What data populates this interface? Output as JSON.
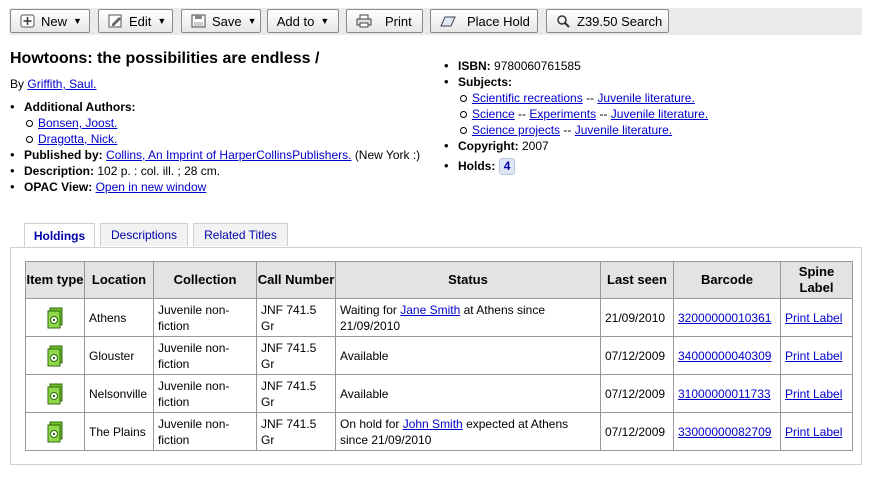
{
  "toolbar": {
    "new": "New",
    "edit": "Edit",
    "save": "Save",
    "add_to": "Add to",
    "print": "Print",
    "place_hold": "Place Hold",
    "z3950": "Z39.50 Search"
  },
  "biblio": {
    "title": "Howtoons: the possibilities are endless /",
    "by_prefix": "By",
    "author": "Griffith, Saul.",
    "additional_authors_label": "Additional Authors:",
    "additional_authors": [
      "Bonsen, Joost.",
      "Dragotta, Nick."
    ],
    "published_label": "Published by:",
    "publisher_link": "Collins, An Imprint of HarperCollinsPublishers.",
    "publisher_place": "(New York :)",
    "description_label": "Description:",
    "description": "102 p. : col. ill. ; 28 cm.",
    "opac_label": "OPAC View:",
    "opac_link": "Open in new window",
    "isbn_label": "ISBN:",
    "isbn": "9780060761585",
    "subjects_label": "Subjects:",
    "subjects": [
      {
        "a": "Scientific recreations",
        "b": "",
        "c": "Juvenile literature."
      },
      {
        "a": "Science",
        "b": "Experiments",
        "c": "Juvenile literature."
      },
      {
        "a": "Science projects",
        "b": "",
        "c": "Juvenile literature."
      }
    ],
    "separator": "--",
    "copyright_label": "Copyright:",
    "copyright": "2007",
    "holds_label": "Holds:",
    "holds": "4"
  },
  "tabs": [
    "Holdings",
    "Descriptions",
    "Related Titles"
  ],
  "holdings": {
    "headers": [
      "Item type",
      "Location",
      "Collection",
      "Call Number",
      "Status",
      "Last seen",
      "Barcode",
      "Spine Label"
    ],
    "rows": [
      {
        "location": "Athens",
        "collection": "Juvenile non-fiction",
        "call": "JNF 741.5 Gr",
        "status_pre": "Waiting for ",
        "status_link": "Jane Smith",
        "status_post": " at Athens since 21/09/2010",
        "last_seen": "21/09/2010",
        "barcode": "32000000010361",
        "spine": "Print Label"
      },
      {
        "location": "Glouster",
        "collection": "Juvenile non-fiction",
        "call": "JNF 741.5 Gr",
        "status_pre": "Available",
        "status_link": "",
        "status_post": "",
        "last_seen": "07/12/2009",
        "barcode": "34000000040309",
        "spine": "Print Label"
      },
      {
        "location": "Nelsonville",
        "collection": "Juvenile non-fiction",
        "call": "JNF 741.5 Gr",
        "status_pre": "Available",
        "status_link": "",
        "status_post": "",
        "last_seen": "07/12/2009",
        "barcode": "31000000011733",
        "spine": "Print Label"
      },
      {
        "location": "The Plains",
        "collection": "Juvenile non-fiction",
        "call": "JNF 741.5 Gr",
        "status_pre": "On hold for ",
        "status_link": "John Smith",
        "status_post": " expected at Athens since 21/09/2010",
        "last_seen": "07/12/2009",
        "barcode": "33000000082709",
        "spine": "Print Label"
      }
    ]
  }
}
